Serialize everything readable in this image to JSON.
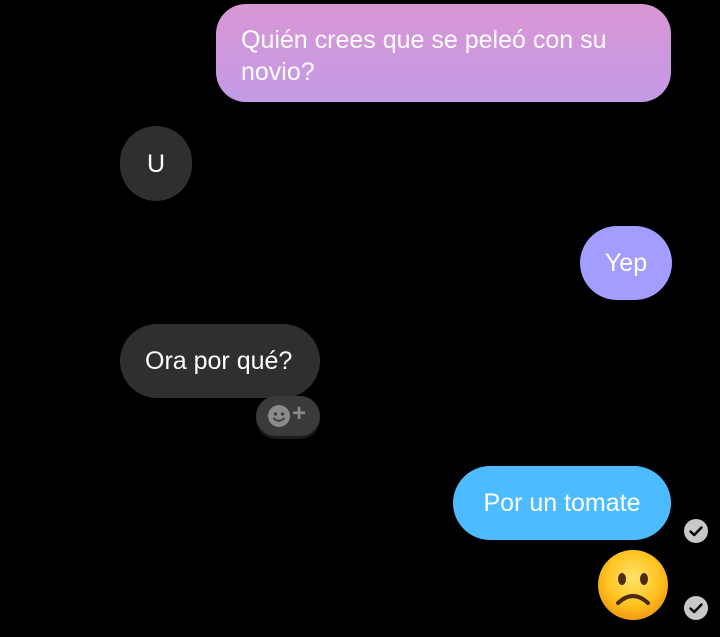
{
  "messages": [
    {
      "sender": "me",
      "text": "Quién crees que se peleó con su novio?"
    },
    {
      "sender": "other",
      "text": "U"
    },
    {
      "sender": "me",
      "text": "Yep"
    },
    {
      "sender": "other",
      "text": "Ora por qué?"
    },
    {
      "sender": "me",
      "text": "Por un tomate"
    },
    {
      "sender": "me",
      "emoji": "frowning-face-emoji"
    }
  ],
  "reaction_button": {
    "icon": "add-reaction-icon",
    "plus": "+"
  },
  "status_icons": [
    "check-circle-icon",
    "check-circle-icon"
  ],
  "colors": {
    "background": "#000000",
    "outgoing_gradient_top": "#d996d4",
    "outgoing_gradient_bottom": "#c39ae6",
    "outgoing_purple": "#a29dff",
    "outgoing_blue": "#4dbbff",
    "incoming": "#2f2f2f",
    "check": "#c8c8c8"
  }
}
